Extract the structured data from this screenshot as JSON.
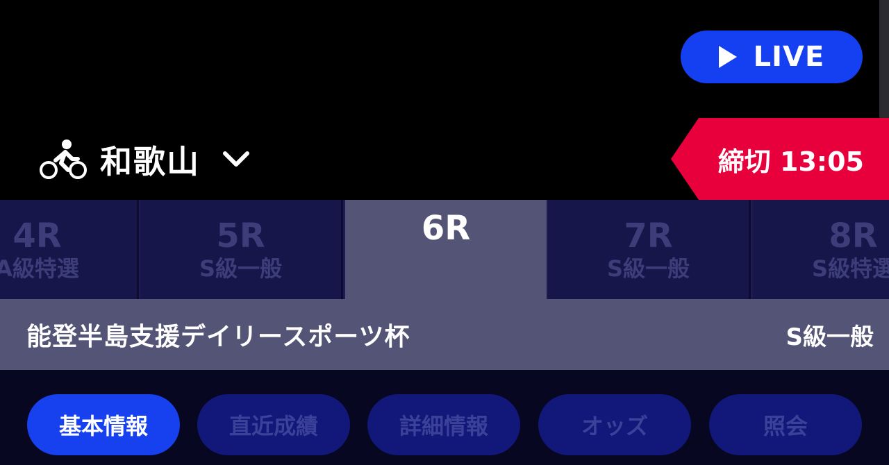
{
  "live_button": {
    "label": "LIVE"
  },
  "venue": {
    "name": "和歌山"
  },
  "deadline": {
    "text": "締切 13:05"
  },
  "race_tabs": [
    {
      "number": "4R",
      "class": "A級特選"
    },
    {
      "number": "5R",
      "class": "S級一般"
    },
    {
      "number": "6R",
      "class": ""
    },
    {
      "number": "7R",
      "class": "S級一般"
    },
    {
      "number": "8R",
      "class": "S級特選"
    }
  ],
  "selected_race": {
    "title": "能登半島支援デイリースポーツ杯",
    "grade": "S級一般"
  },
  "info_tabs": [
    {
      "label": "基本情報"
    },
    {
      "label": "直近成績"
    },
    {
      "label": "詳細情報"
    },
    {
      "label": "オッズ"
    },
    {
      "label": "照会"
    }
  ],
  "colors": {
    "live_blue": "#1540f2",
    "deadline_red": "#e8003c",
    "active_tab": "#545476",
    "inactive_tab": "#16164a",
    "info_tab_active": "#1741ef",
    "info_tab_inactive": "#12187a"
  }
}
